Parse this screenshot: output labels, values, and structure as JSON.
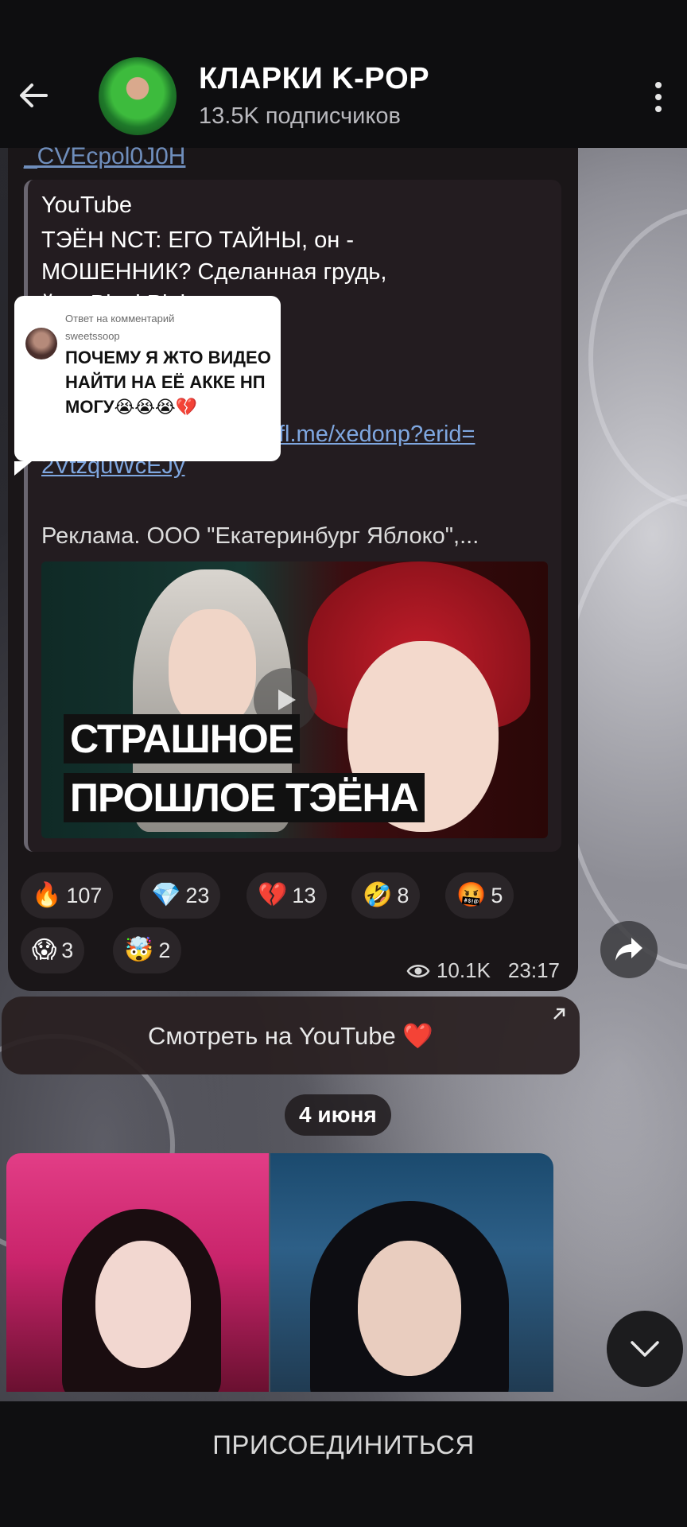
{
  "header": {
    "title": "КЛАРКИ K-POP",
    "subscribers": "13.5K подписчиков"
  },
  "post": {
    "prev_link_tail": "_CVEcpol0J0H",
    "preview": {
      "source": "YouTube",
      "text": "ТЭЁН NCT: ЕГО ТАЙНЫ, он -\nМОШЕННИК? Сделанная грудь,\n                                    й из BlackPink,\n\n                                    НА & ВНА PORE\n                                    R в Золотом Яблоке:",
      "link": "2VtzquWcEJy",
      "link_partial": "fl.me/xedonp?erid=",
      "ad": "Реклама. ООО \"Екатеринбург Яблоко\",..."
    },
    "thumbnail": {
      "caption_line1": "СТРАШНОЕ",
      "caption_line2": "ПРОШЛОЕ ТЭЁНА"
    },
    "reactions": [
      {
        "emoji": "🔥",
        "count": "107"
      },
      {
        "emoji": "💎",
        "count": "23"
      },
      {
        "emoji": "💔",
        "count": "13"
      },
      {
        "emoji": "🤣",
        "count": "8"
      },
      {
        "emoji": "🤬",
        "count": "5"
      },
      {
        "emoji": "😱",
        "count": "3"
      },
      {
        "emoji": "🤯",
        "count": "2"
      }
    ],
    "views": "10.1K",
    "time": "23:17"
  },
  "reply_card": {
    "label": "Ответ на комментарий",
    "username": "sweetssoop",
    "text": "ПОЧЕМУ Я ЖТО ВИДЕО НАЙТИ НА ЕЁ АККЕ НП МОГУ😭😭😭💔"
  },
  "youtube_button": "Смотреть на YouTube ❤️",
  "date_separator": "4 июня",
  "bottom": {
    "join_label": "ПРИСОЕДИНИТЬСЯ"
  },
  "colors": {
    "link": "#7fa7e0",
    "bubble_bg": "#1a1618",
    "reaction_bg": "#2a2528"
  },
  "icons": {
    "back": "arrow-left-icon",
    "menu": "more-vertical-icon",
    "play": "play-icon",
    "eye": "eye-icon",
    "share": "share-arrow-icon",
    "external": "external-link-icon",
    "scroll": "chevron-down-icon"
  }
}
